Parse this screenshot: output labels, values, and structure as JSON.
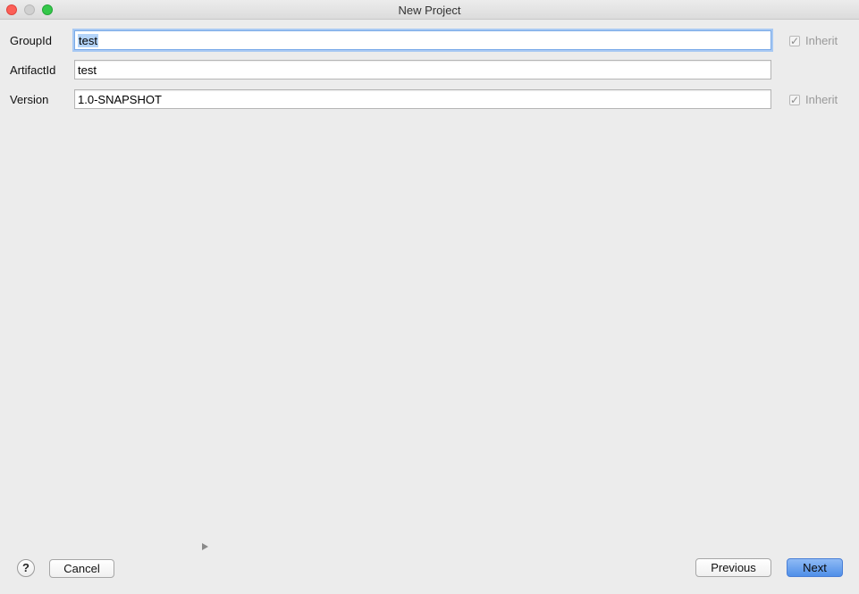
{
  "window": {
    "title": "New Project"
  },
  "form": {
    "group_id": {
      "label": "GroupId",
      "value": "test",
      "inherit_label": "Inherit",
      "inherit_checked": true
    },
    "artifact_id": {
      "label": "ArtifactId",
      "value": "test"
    },
    "version": {
      "label": "Version",
      "value": "1.0-SNAPSHOT",
      "inherit_label": "Inherit",
      "inherit_checked": true
    }
  },
  "footer": {
    "help_label": "?",
    "cancel_label": "Cancel",
    "previous_label": "Previous",
    "next_label": "Next"
  },
  "icons": {
    "checkmark": "✓",
    "expander": "triangle-right"
  },
  "colors": {
    "focus_ring": "#a8c9f3",
    "selection": "#b4d4f9",
    "default_button": "#4f8fe8",
    "close": "#fc5f57",
    "maximize": "#34c84a"
  }
}
